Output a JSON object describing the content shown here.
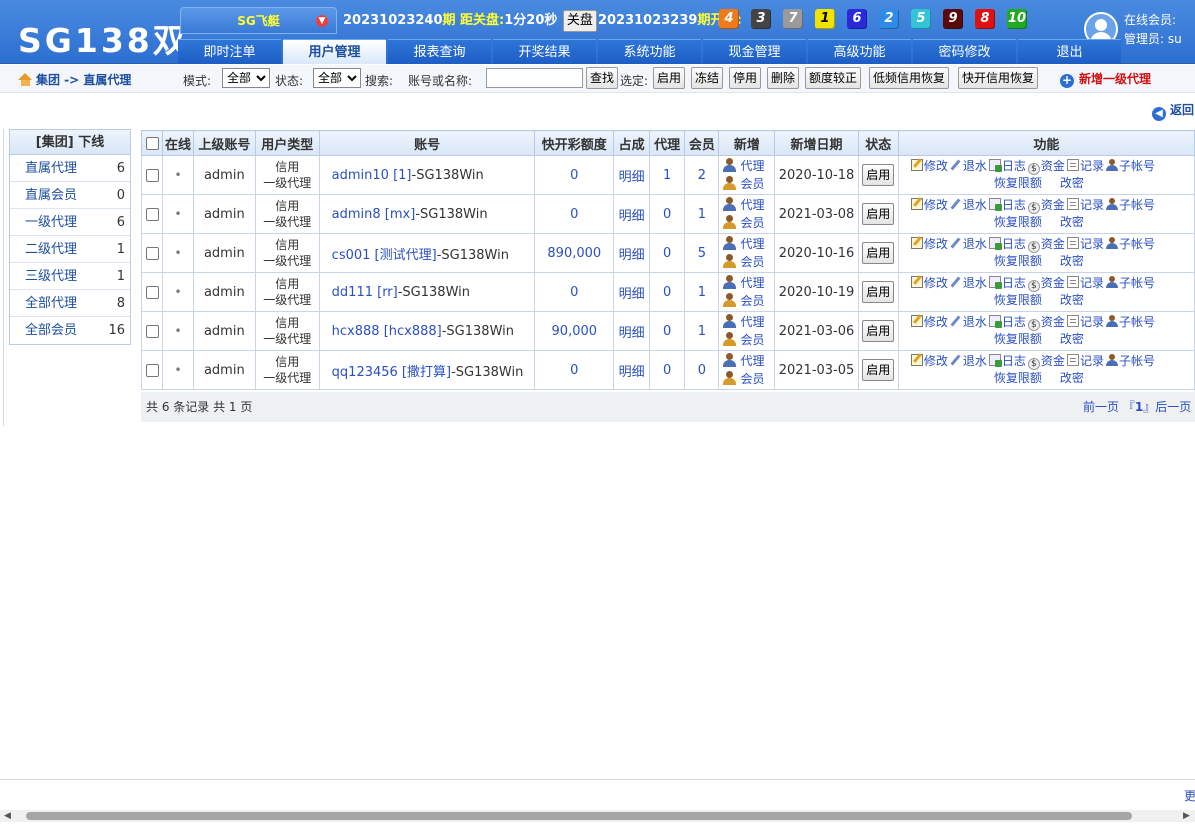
{
  "header": {
    "logo": "SG138双",
    "game_tab": "SG飞艇",
    "issue": {
      "current_issue": "20231023240",
      "current_suffix": "期",
      "close_label": "距关盘:",
      "countdown": "1分20秒",
      "close_button": "关盘",
      "last_issue": "20231023239",
      "last_suffix": "期开奖:"
    },
    "balls": [
      {
        "n": "4",
        "color": "#f07a1a"
      },
      {
        "n": "3",
        "color": "#444444"
      },
      {
        "n": "7",
        "color": "#9a9a9a"
      },
      {
        "n": "1",
        "color": "#f2e400"
      },
      {
        "n": "6",
        "color": "#2a2ad8"
      },
      {
        "n": "2",
        "color": "#2f8ae8"
      },
      {
        "n": "5",
        "color": "#33c4d8"
      },
      {
        "n": "9",
        "color": "#5a0a0a"
      },
      {
        "n": "8",
        "color": "#e01010"
      },
      {
        "n": "10",
        "color": "#22aa22"
      }
    ],
    "user": {
      "online": "在线会员:",
      "admin": "管理员: su"
    },
    "nav": [
      "即时注单",
      "用户管理",
      "报表查询",
      "开奖结果",
      "系统功能",
      "现金管理",
      "高级功能",
      "密码修改",
      "退出"
    ]
  },
  "toolbar": {
    "breadcrumb": "集团 -> 直属代理",
    "mode_label": "模式:",
    "mode_value": "全部",
    "status_label": "状态:",
    "status_value": "全部",
    "search_label": "搜索:",
    "account_label": "账号或名称:",
    "search_input": "",
    "find_button": "查找",
    "select_label": "选定:",
    "buttons": [
      "启用",
      "冻结",
      "停用",
      "删除",
      "额度较正",
      "低频信用恢复",
      "快开信用恢复"
    ],
    "add_agent": "新增一级代理",
    "return": "返回"
  },
  "sidebar": {
    "header": "[集团] 下线",
    "items": [
      {
        "label": "直属代理",
        "count": "6"
      },
      {
        "label": "直属会员",
        "count": "0"
      },
      {
        "label": "一级代理",
        "count": "6"
      },
      {
        "label": "二级代理",
        "count": "1"
      },
      {
        "label": "三级代理",
        "count": "1"
      },
      {
        "label": "全部代理",
        "count": "8"
      },
      {
        "label": "全部会员",
        "count": "16"
      }
    ]
  },
  "table": {
    "headers": [
      "",
      "在线",
      "上级账号",
      "用户类型",
      "账号",
      "快开彩额度",
      "占成",
      "代理",
      "会员",
      "新增",
      "新增日期",
      "状态",
      "功能"
    ],
    "rows": [
      {
        "online": "•",
        "parent": "admin",
        "type1": "信用",
        "type2": "一级代理",
        "account": "admin10 [1]",
        "suffix": "-SG138Win",
        "quota": "0",
        "share": "明细",
        "agents": "1",
        "members": "2",
        "date": "2020-10-18",
        "state": "启用"
      },
      {
        "online": "•",
        "parent": "admin",
        "type1": "信用",
        "type2": "一级代理",
        "account": "admin8 [mx]",
        "suffix": "-SG138Win",
        "quota": "0",
        "share": "明细",
        "agents": "0",
        "members": "1",
        "date": "2021-03-08",
        "state": "启用"
      },
      {
        "online": "•",
        "parent": "admin",
        "type1": "信用",
        "type2": "一级代理",
        "account": "cs001 [测试代理]",
        "suffix": "-SG138Win",
        "quota": "890,000",
        "share": "明细",
        "agents": "0",
        "members": "5",
        "date": "2020-10-16",
        "state": "启用"
      },
      {
        "online": "•",
        "parent": "admin",
        "type1": "信用",
        "type2": "一级代理",
        "account": "dd111 [rr]",
        "suffix": "-SG138Win",
        "quota": "0",
        "share": "明细",
        "agents": "0",
        "members": "1",
        "date": "2020-10-19",
        "state": "启用"
      },
      {
        "online": "•",
        "parent": "admin",
        "type1": "信用",
        "type2": "一级代理",
        "account": "hcx888 [hcx888]",
        "suffix": "-SG138Win",
        "quota": "90,000",
        "share": "明细",
        "agents": "0",
        "members": "1",
        "date": "2021-03-06",
        "state": "启用"
      },
      {
        "online": "•",
        "parent": "admin",
        "type1": "信用",
        "type2": "一级代理",
        "account": "qq123456 [撒打算]",
        "suffix": "-SG138Win",
        "quota": "0",
        "share": "明细",
        "agents": "0",
        "members": "0",
        "date": "2021-03-05",
        "state": "启用"
      }
    ],
    "add_labels": {
      "agent": "代理",
      "member": "会员"
    },
    "func_labels": {
      "edit": "修改",
      "rebate": "退水",
      "log": "日志",
      "funds": "资金",
      "record": "记录",
      "sub": "子帐号",
      "restore": "恢复限额",
      "password": "改密"
    },
    "money_symbol": "$"
  },
  "pager": {
    "info": "共 6 条记录 共 1 页",
    "prev": "前一页",
    "lb": "『",
    "page": "1",
    "rb": "』",
    "next": "后一页"
  },
  "footer": {
    "right": "更"
  }
}
